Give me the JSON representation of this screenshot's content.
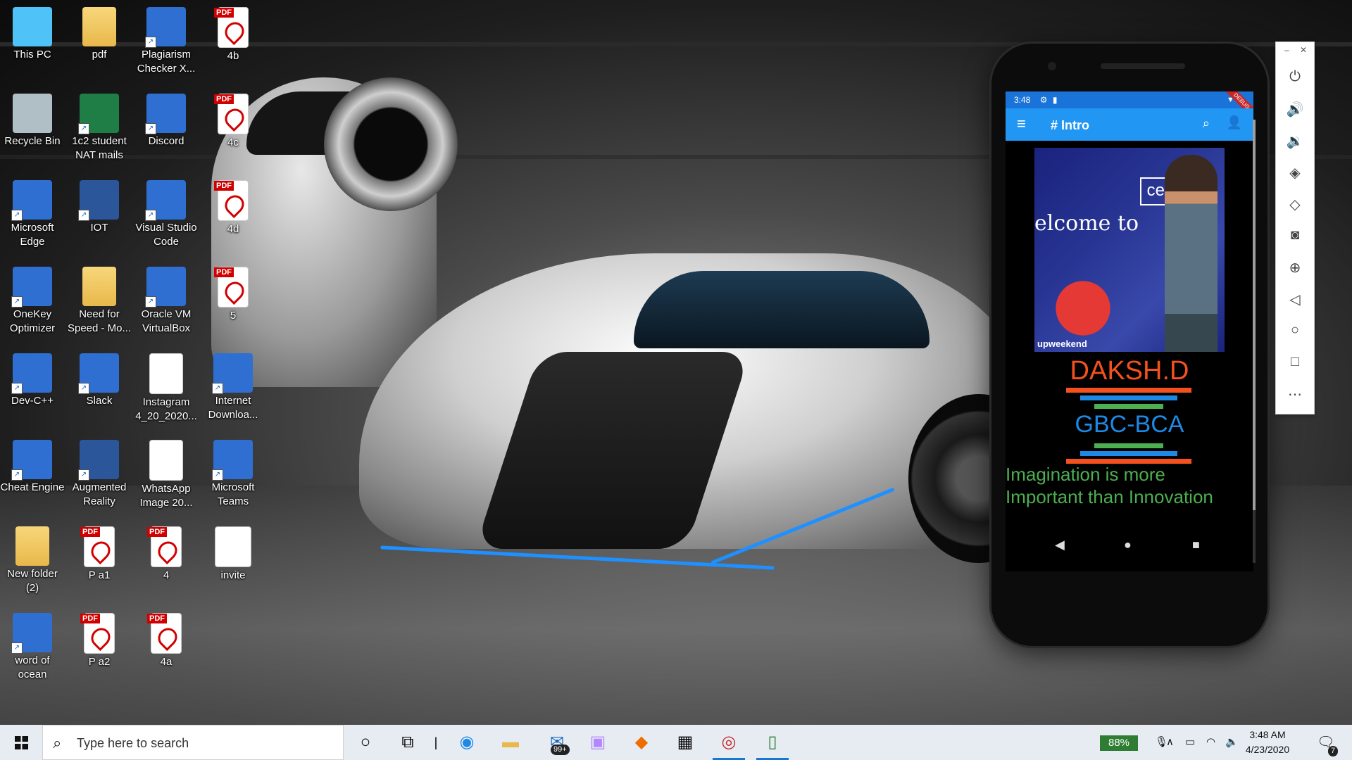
{
  "desktop": {
    "icons": [
      {
        "label": "This PC",
        "kind": "pc"
      },
      {
        "label": "pdf",
        "kind": "folder"
      },
      {
        "label": "Plagiarism Checker X...",
        "kind": "app"
      },
      {
        "label": "4b",
        "kind": "pdf"
      },
      {
        "label": "Recycle Bin",
        "kind": "bin"
      },
      {
        "label": "1c2 student NAT mails",
        "kind": "excel"
      },
      {
        "label": "Discord",
        "kind": "app"
      },
      {
        "label": "4c",
        "kind": "pdf"
      },
      {
        "label": "Microsoft Edge",
        "kind": "app"
      },
      {
        "label": "IOT",
        "kind": "word"
      },
      {
        "label": "Visual Studio Code",
        "kind": "app"
      },
      {
        "label": "4d",
        "kind": "pdf"
      },
      {
        "label": "OneKey Optimizer",
        "kind": "app"
      },
      {
        "label": "Need for Speed - Mo...",
        "kind": "folder"
      },
      {
        "label": "Oracle VM VirtualBox",
        "kind": "app"
      },
      {
        "label": "5",
        "kind": "pdf"
      },
      {
        "label": "Dev-C++",
        "kind": "app"
      },
      {
        "label": "Slack",
        "kind": "app"
      },
      {
        "label": "Instagram 4_20_2020...",
        "kind": "image"
      },
      {
        "label": "Internet Downloa...",
        "kind": "app"
      },
      {
        "label": "Cheat Engine",
        "kind": "app"
      },
      {
        "label": "Augmented Reality",
        "kind": "word"
      },
      {
        "label": "WhatsApp Image 20...",
        "kind": "image"
      },
      {
        "label": "Microsoft Teams",
        "kind": "app"
      },
      {
        "label": "New folder (2)",
        "kind": "folder"
      },
      {
        "label": "P a1",
        "kind": "pdf"
      },
      {
        "label": "4",
        "kind": "pdf"
      },
      {
        "label": "invite",
        "kind": "blank"
      },
      {
        "label": "word of ocean",
        "kind": "app"
      },
      {
        "label": "P a2",
        "kind": "pdf"
      },
      {
        "label": "4a",
        "kind": "pdf"
      }
    ]
  },
  "emulator": {
    "status_time": "3:48",
    "ribbon": "DEBUG",
    "app_title": "# Intro",
    "photo_welcome": "elcome to",
    "photo_logo": "cee",
    "photo_footer": "upweekend",
    "name": "DAKSH.D",
    "course": "GBC-BCA",
    "quote_line1": "Imagination is more",
    "quote_line2": "Important than Innovation",
    "colors": {
      "name": "#f4511e",
      "course": "#1e88e5",
      "quote": "#4caf50",
      "app_bar": "#2196f3"
    },
    "side_tools": [
      "power-icon",
      "volume-up-icon",
      "volume-down-icon",
      "rotate-left-icon",
      "rotate-right-icon",
      "camera-icon",
      "zoom-icon",
      "back-icon",
      "home-icon",
      "overview-icon",
      "more-icon"
    ]
  },
  "taskbar": {
    "search_placeholder": "Type here to search",
    "mail_badge": "99+",
    "battery": "88%",
    "time": "3:48 AM",
    "date": "4/23/2020",
    "notification_count": "7"
  }
}
